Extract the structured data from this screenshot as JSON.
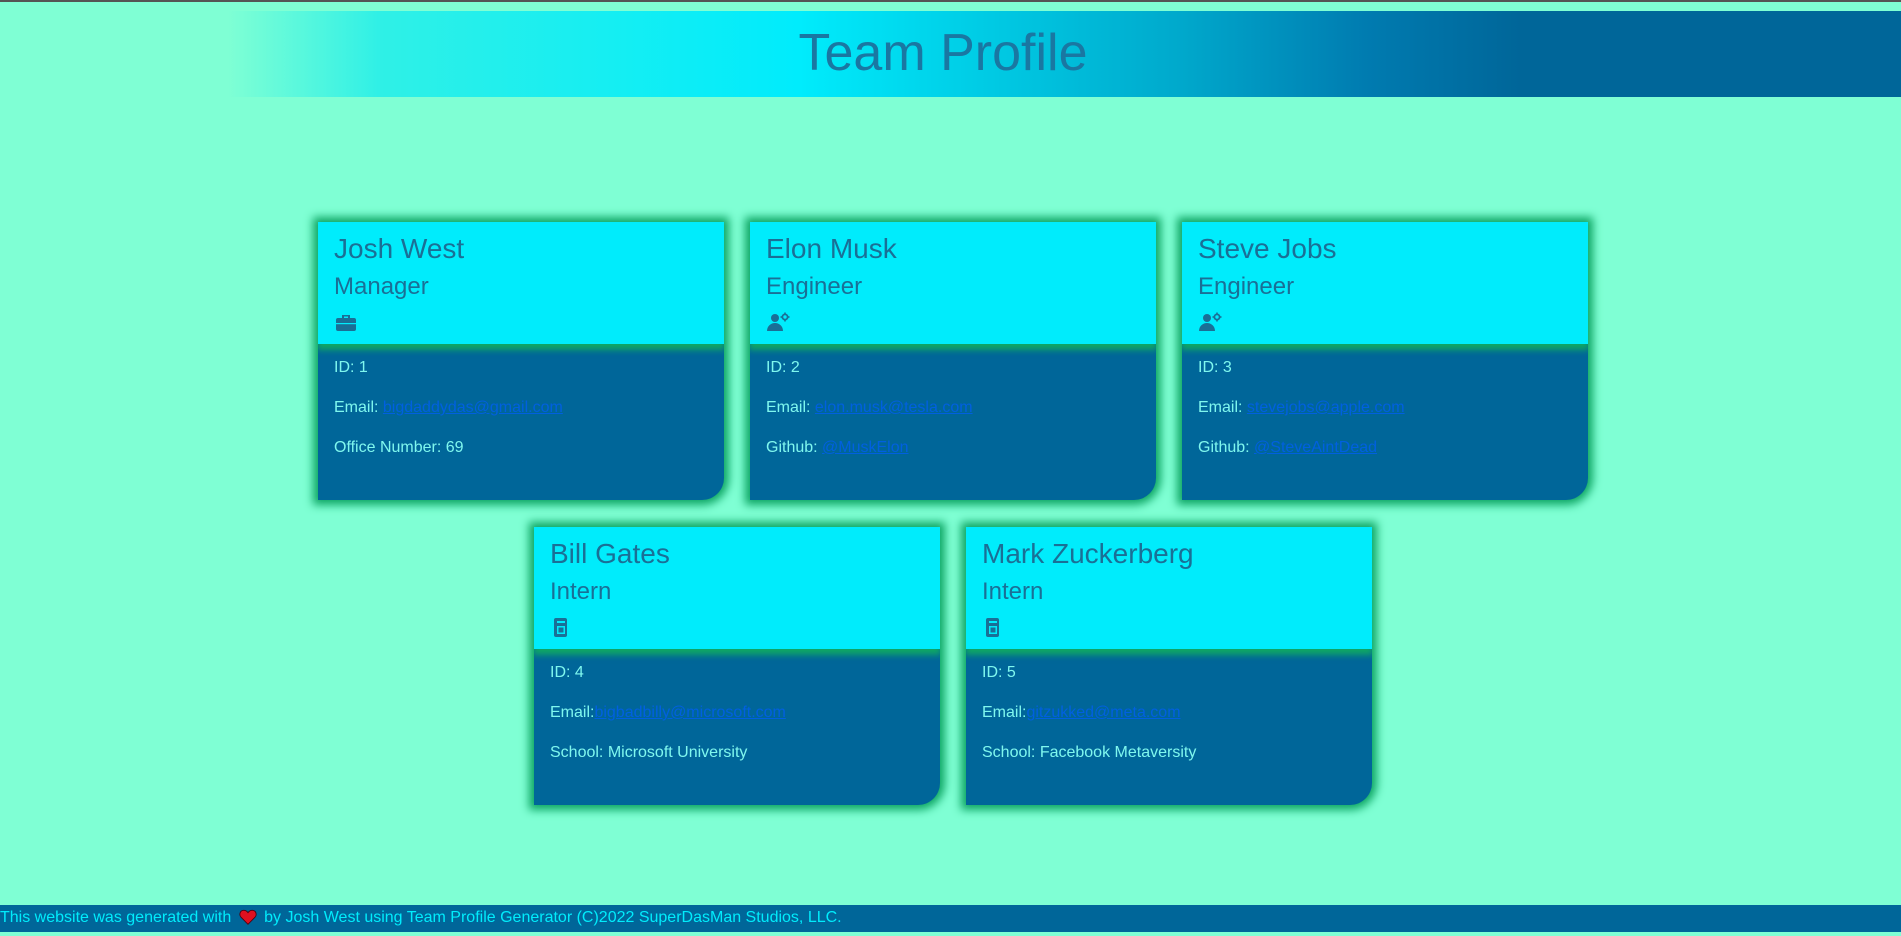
{
  "header": {
    "title": "Team Profile"
  },
  "cards": [
    {
      "name": "Josh West",
      "role": "Manager",
      "icon": "briefcase-icon",
      "id_text": "ID: 1",
      "email_label": "Email: ",
      "email": "bigdaddydas@gmail.com",
      "extra_label": "Office Number: 69",
      "extra_link": ""
    },
    {
      "name": "Elon Musk",
      "role": "Engineer",
      "icon": "engineer-icon",
      "id_text": "ID: 2",
      "email_label": "Email: ",
      "email": "elon.musk@tesla.com",
      "extra_label": "Github: ",
      "extra_link": "@MuskElon"
    },
    {
      "name": "Steve Jobs",
      "role": "Engineer",
      "icon": "engineer-icon",
      "id_text": "ID: 3",
      "email_label": "Email: ",
      "email": "stevejobs@apple.com",
      "extra_label": "Github: ",
      "extra_link": "@SteveAintDead"
    },
    {
      "name": "Bill Gates",
      "role": "Intern",
      "icon": "mug-icon",
      "id_text": "ID: 4",
      "email_label": "Email:",
      "email": "bigbadbilly@microsoft.com",
      "extra_label": "School: Microsoft University",
      "extra_link": ""
    },
    {
      "name": "Mark Zuckerberg",
      "role": "Intern",
      "icon": "mug-icon",
      "id_text": "ID: 5",
      "email_label": "Email:",
      "email": "gitzukked@meta.com",
      "extra_label": "School: Facebook Metaversity",
      "extra_link": ""
    }
  ],
  "footer": {
    "text_before": "This website was generated with",
    "icon": "heart-icon",
    "text_after": "by Josh West using Team Profile Generator (C)2022 SuperDasMan Studios, LLC."
  },
  "colors": {
    "background": "#7fffd4",
    "card_head": "#00ecfc",
    "card_body": "#006699",
    "glow": "#0fa765",
    "link": "#0060e0"
  }
}
